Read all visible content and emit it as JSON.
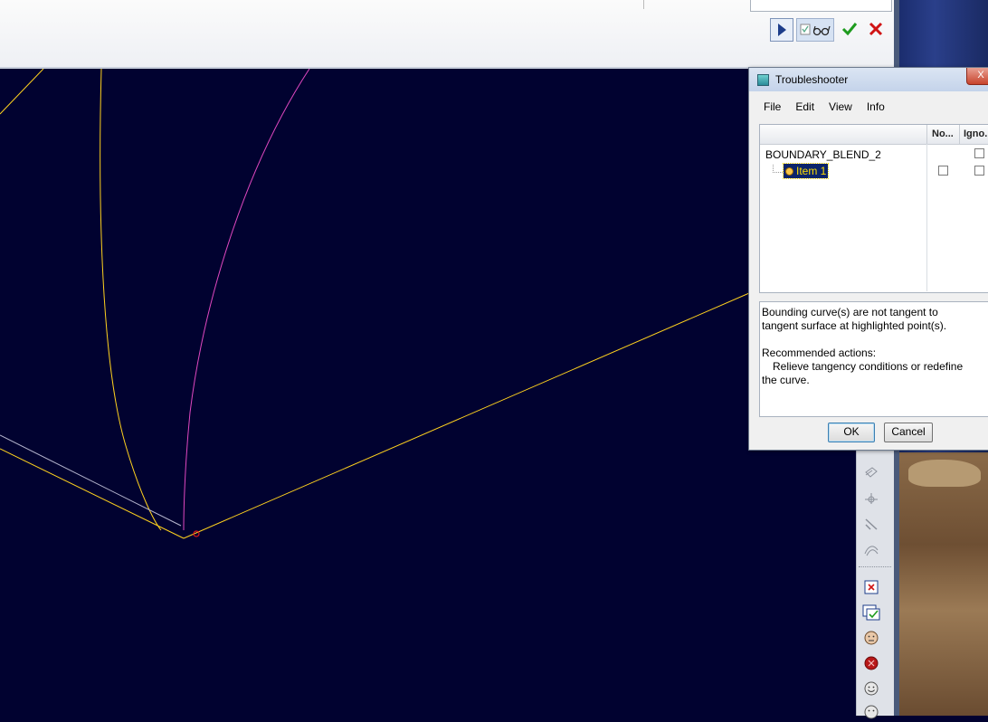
{
  "toolbar": {
    "play_icon": "play-icon",
    "glasses_icon": "glasses-icon",
    "ok_icon": "checkmark-icon",
    "cancel_icon": "x-icon",
    "ok_color": "#1e9b1e",
    "cancel_color": "#d01414"
  },
  "viewport": {
    "background": "#010230",
    "curve_yellow": "#ffd21e",
    "curve_magenta": "#e048c0",
    "edge_gray": "#b8b8d0",
    "marker_red": "#e01818"
  },
  "dialog": {
    "title": "Troubleshooter",
    "close_label": "X",
    "menu": [
      "File",
      "Edit",
      "View",
      "Info"
    ],
    "columns": {
      "note": "No...",
      "ignore": "Igno..."
    },
    "tree": {
      "root": "BOUNDARY_BLEND_2",
      "item": "Item 1"
    },
    "message": {
      "line1": "Bounding curve(s) are not tangent to tangent surface at highlighted point(s).",
      "heading": "Recommended actions:",
      "action": "Relieve tangency conditions or redefine the curve."
    },
    "ok_label": "OK",
    "cancel_label": "Cancel"
  },
  "sidebar": {
    "icons": [
      "surface-copy-icon",
      "split-icon",
      "trim-icon",
      "offset-surface-icon",
      "close-feature-icon",
      "verify-icon",
      "face-neutral-icon",
      "stop-red-icon",
      "face-smile-icon",
      "face-icon"
    ]
  }
}
